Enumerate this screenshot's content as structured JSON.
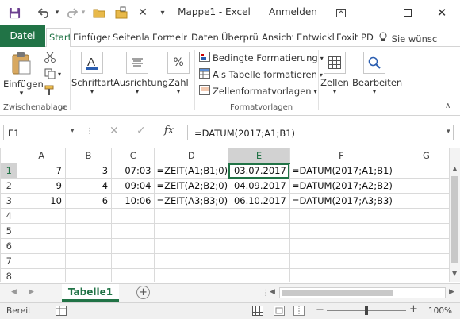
{
  "window": {
    "title": "Mappe1  -  Excel",
    "signin": "Anmelden"
  },
  "tabs": [
    {
      "label": "Datei"
    },
    {
      "label": "Start"
    },
    {
      "label": "Einfüger"
    },
    {
      "label": "Seitenlay"
    },
    {
      "label": "Formeln"
    },
    {
      "label": "Daten"
    },
    {
      "label": "Überprül"
    },
    {
      "label": "Ansicht"
    },
    {
      "label": "Entwickl"
    },
    {
      "label": "Foxit PDI"
    }
  ],
  "tell_me": "Sie wünsc",
  "ribbon": {
    "paste": "Einfügen",
    "clipboard_label": "Zwischenablage",
    "font": "Schriftart",
    "alignment": "Ausrichtung",
    "number": "Zahl",
    "number_icon": "%",
    "cond_format": "Bedingte Formatierung",
    "as_table": "Als Tabelle formatieren",
    "cell_styles": "Zellenformatvorlagen",
    "styles_label": "Formatvorlagen",
    "cells": "Zellen",
    "editing": "Bearbeiten"
  },
  "formula_bar": {
    "name_box": "E1",
    "fx": "fx",
    "formula": "=DATUM(2017;A1;B1)"
  },
  "grid": {
    "columns": [
      "A",
      "B",
      "C",
      "D",
      "E",
      "F",
      "G"
    ],
    "rows": [
      {
        "n": "1",
        "a": "7",
        "b": "3",
        "c": "07:03",
        "d": "=ZEIT(A1;B1;0)",
        "e": "03.07.2017",
        "f": "=DATUM(2017;A1;B1)"
      },
      {
        "n": "2",
        "a": "9",
        "b": "4",
        "c": "09:04",
        "d": "=ZEIT(A2;B2;0)",
        "e": "04.09.2017",
        "f": "=DATUM(2017;A2;B2)"
      },
      {
        "n": "3",
        "a": "10",
        "b": "6",
        "c": "10:06",
        "d": "=ZEIT(A3;B3;0)",
        "e": "06.10.2017",
        "f": "=DATUM(2017;A3;B3)"
      },
      {
        "n": "4",
        "a": "",
        "b": "",
        "c": "",
        "d": "",
        "e": "",
        "f": ""
      },
      {
        "n": "5",
        "a": "",
        "b": "",
        "c": "",
        "d": "",
        "e": "",
        "f": ""
      },
      {
        "n": "6",
        "a": "",
        "b": "",
        "c": "",
        "d": "",
        "e": "",
        "f": ""
      },
      {
        "n": "7",
        "a": "",
        "b": "",
        "c": "",
        "d": "",
        "e": "",
        "f": ""
      },
      {
        "n": "8",
        "a": "",
        "b": "",
        "c": "",
        "d": "",
        "e": "",
        "f": ""
      }
    ]
  },
  "sheet": {
    "tab": "Tabelle1"
  },
  "status": {
    "ready": "Bereit",
    "zoom": "100%"
  },
  "colors": {
    "accent": "#217346"
  }
}
